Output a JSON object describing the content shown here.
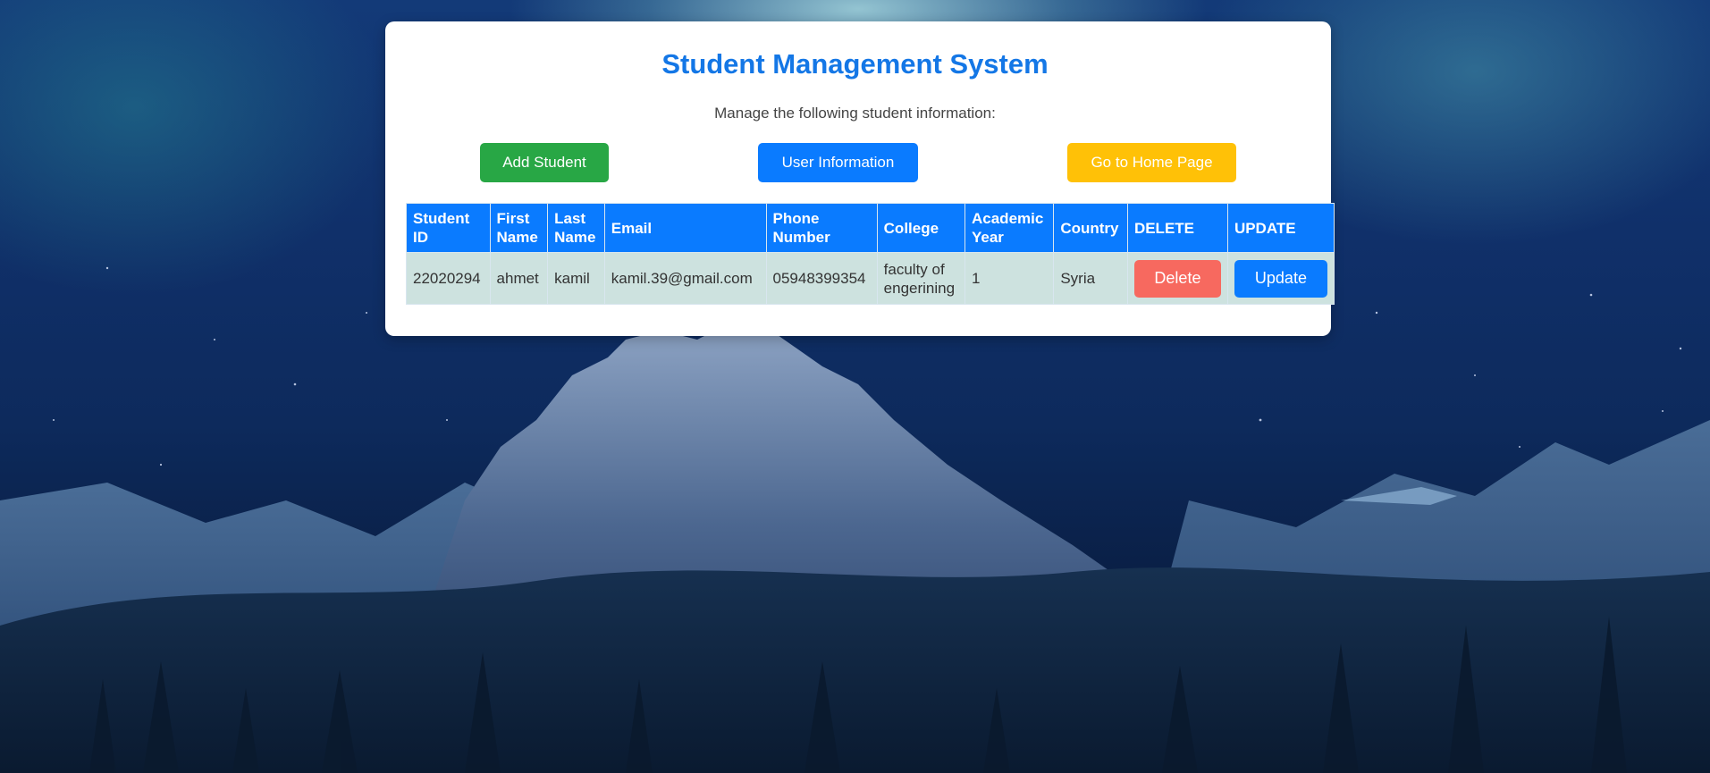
{
  "header": {
    "title": "Student Management System",
    "subtitle": "Manage the following student information:"
  },
  "actions": {
    "add_student": "Add Student",
    "user_information": "User Information",
    "home_page": "Go to Home Page"
  },
  "colors": {
    "title": "#1477e6",
    "add_button": "#28a745",
    "user_button": "#0a7bff",
    "home_button": "#ffc107",
    "delete_button": "#f7695f",
    "header_row": "#0a7bff",
    "data_row": "#cde2df"
  },
  "table": {
    "columns": [
      "Student ID",
      "First Name",
      "Last Name",
      "Email",
      "Phone Number",
      "College",
      "Academic Year",
      "Country",
      "DELETE",
      "UPDATE"
    ],
    "rows": [
      {
        "student_id": "22020294",
        "first_name": "ahmet",
        "last_name": "kamil",
        "email": "kamil.39@gmail.com",
        "phone": "05948399354",
        "college": "faculty of engerining",
        "academic_year": "1",
        "country": "Syria",
        "delete_label": "Delete",
        "update_label": "Update"
      }
    ]
  }
}
